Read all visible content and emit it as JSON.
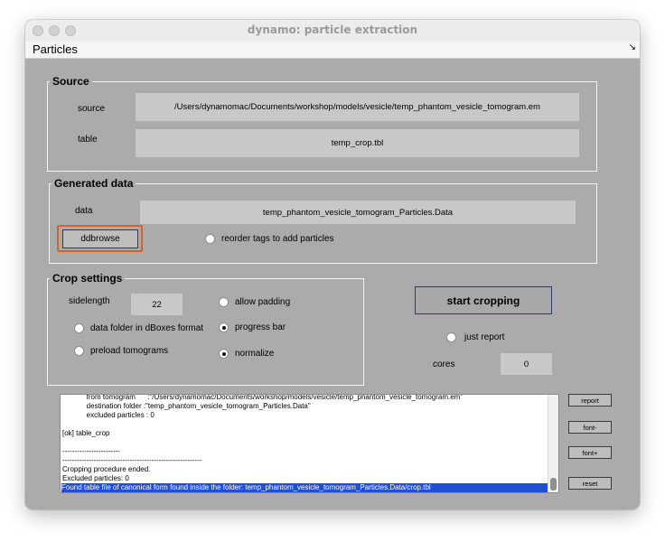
{
  "window": {
    "title": "dynamo: particle extraction"
  },
  "menu": {
    "title": "Particles",
    "corner_icon": "↘"
  },
  "source": {
    "title": "Source",
    "source_label": "source",
    "source_value": "/Users/dynamomac/Documents/workshop/models/vesicle/temp_phantom_vesicle_tomogram.em",
    "table_label": "table",
    "table_value": "temp_crop.tbl"
  },
  "generated": {
    "title": "Generated data",
    "data_label": "data",
    "data_value": "temp_phantom_vesicle_tomogram_Particles.Data",
    "ddbrowse_label": "ddbrowse",
    "reorder_label": "reorder tags to add particles"
  },
  "crop": {
    "title": "Crop settings",
    "sidelength_label": "sidelength",
    "sidelength_value": "22",
    "allow_padding": "allow padding",
    "dboxes_format": "data folder in dBoxes format",
    "progress_bar": "progress bar",
    "preload": "preload tomograms",
    "normalize": "normalize"
  },
  "actions": {
    "start_label": "start cropping",
    "just_report": "just report",
    "cores_label": "cores",
    "cores_value": "0"
  },
  "console": {
    "lines": [
      "            from tomogram      :\"/Users/dynamomac/Documents/workshop/models/vesicle/temp_phantom_vesicle_tomogram.em\"",
      "            destination folder :\"temp_phantom_vesicle_tomogram_Particles.Data\"",
      "            excluded particles : 0",
      "",
      "[ok] table_crop",
      "",
      "------------------------",
      "----------------------------------------------------------",
      "Cropping procedure ended.",
      "Excluded particles: 0",
      "Found table file of canonical form found inside the folder: temp_phantom_vesicle_tomogram_Particles.Data/crop.tbl"
    ]
  },
  "side_buttons": {
    "report": "report",
    "font_minus": "font-",
    "font_plus": "font+",
    "reset": "reset"
  },
  "colors": {
    "window_bg": "#ababab",
    "highlight_border": "#d4622c",
    "selection": "#1f4fd3"
  }
}
